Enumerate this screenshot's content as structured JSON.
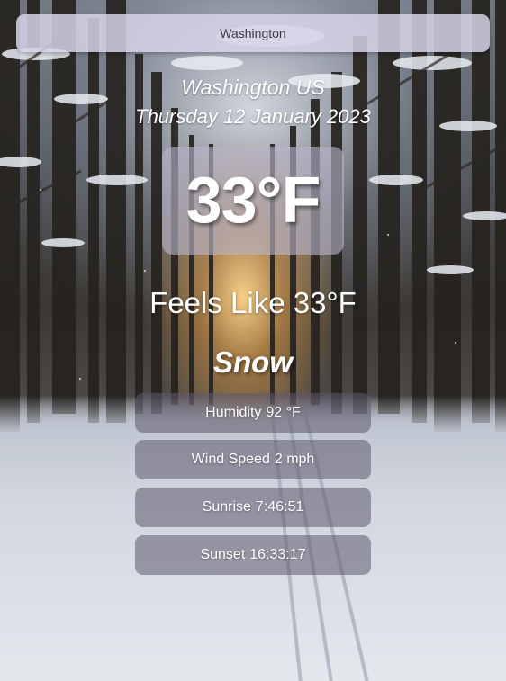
{
  "search": {
    "value": "Washington"
  },
  "location": {
    "city": "Washington",
    "country": "US"
  },
  "date": "Thursday 12 January 2023",
  "temperature": "33°F",
  "feels_like": "Feels Like 33°F",
  "condition": "Snow",
  "stats": {
    "humidity": {
      "label": "Humidity",
      "value": "92 °F"
    },
    "wind_speed": {
      "label": "Wind Speed",
      "value": "2 mph"
    },
    "sunrise": {
      "label": "Sunrise",
      "value": "7:46:51"
    },
    "sunset": {
      "label": "Sunset",
      "value": "16:33:17"
    }
  }
}
